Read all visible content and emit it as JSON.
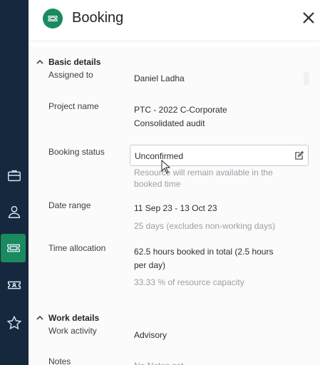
{
  "rail": {
    "items": [
      {
        "icon": "briefcase-icon"
      },
      {
        "icon": "user-icon"
      },
      {
        "icon": "booking-ticket-icon"
      },
      {
        "icon": "id-card-icon"
      },
      {
        "icon": "star-icon"
      }
    ],
    "active_color": "#1a8a5f",
    "background": "#16283d"
  },
  "header": {
    "title": "Booking",
    "icon": "booking-ticket-icon",
    "close_icon": "close-icon"
  },
  "basic": {
    "heading": "Basic details",
    "assigned_label": "Assigned to",
    "assigned_value": "Daniel Ladha",
    "project_label": "Project name",
    "project_line1": "PTC - 2022 C-Corporate",
    "project_line2": "Consolidated audit",
    "status_label": "Booking status",
    "status_value": "Unconfirmed",
    "status_hint1": "Resource will remain available in the",
    "status_hint2": "booked time",
    "date_label": "Date range",
    "date_value": "11 Sep 23 - 13 Oct 23",
    "date_hint": "25 days (excludes non-working days)",
    "time_label": "Time allocation",
    "time_line1": "62.5 hours booked in total (2.5 hours",
    "time_line2": "per day)",
    "time_hint": "33.33 % of resource capacity"
  },
  "work": {
    "heading": "Work details",
    "activity_label": "Work activity",
    "activity_value": "Advisory",
    "notes_label": "Notes",
    "notes_value": "No Notes set"
  }
}
